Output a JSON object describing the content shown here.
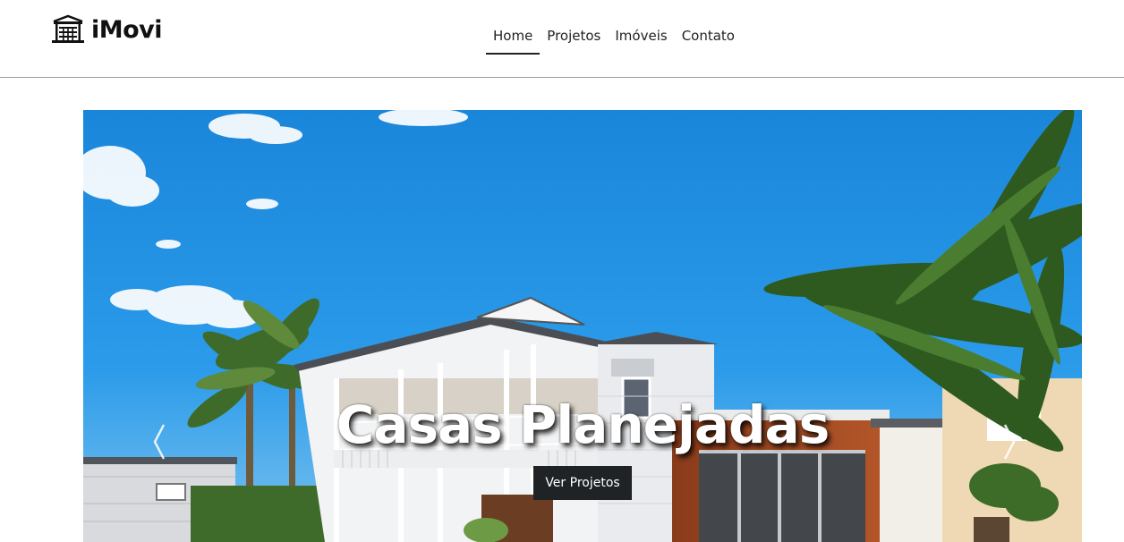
{
  "brand": {
    "name": "iMovi",
    "icon": "house-logo-icon"
  },
  "nav": {
    "items": [
      {
        "label": "Home",
        "active": true
      },
      {
        "label": "Projetos",
        "active": false
      },
      {
        "label": "Imóveis",
        "active": false
      },
      {
        "label": "Contato",
        "active": false
      }
    ]
  },
  "hero": {
    "title": "Casas Planejadas",
    "button_label": "Ver Projetos",
    "prev_icon": "chevron-left-icon",
    "next_icon": "chevron-right-icon"
  },
  "colors": {
    "sky": "#1f8fe0",
    "button_bg": "#1f2326",
    "divider": "#9a9a9a"
  }
}
